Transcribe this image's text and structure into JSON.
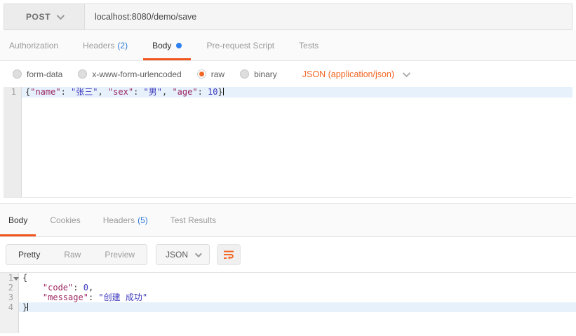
{
  "request": {
    "method": "POST",
    "url": "localhost:8080/demo/save",
    "tabs": {
      "authorization": "Authorization",
      "headers": "Headers",
      "headers_count": "(2)",
      "body": "Body",
      "prerequest": "Pre-request Script",
      "tests": "Tests"
    },
    "body_types": {
      "form_data": "form-data",
      "urlencoded": "x-www-form-urlencoded",
      "raw": "raw",
      "binary": "binary",
      "selected": "raw"
    },
    "content_type": "JSON (application/json)",
    "editor": {
      "line_number": "1",
      "tokens": [
        {
          "type": "punct",
          "text": "{"
        },
        {
          "type": "key",
          "text": "\"name\""
        },
        {
          "type": "punct",
          "text": ": "
        },
        {
          "type": "str",
          "text": "\"张三\""
        },
        {
          "type": "punct",
          "text": ", "
        },
        {
          "type": "key",
          "text": "\"sex\""
        },
        {
          "type": "punct",
          "text": ": "
        },
        {
          "type": "str",
          "text": "\"男\""
        },
        {
          "type": "punct",
          "text": ", "
        },
        {
          "type": "key",
          "text": "\"age\""
        },
        {
          "type": "punct",
          "text": ": "
        },
        {
          "type": "num",
          "text": "10"
        },
        {
          "type": "punct",
          "text": "}"
        }
      ]
    }
  },
  "response": {
    "tabs": {
      "body": "Body",
      "cookies": "Cookies",
      "headers": "Headers",
      "headers_count": "(5)",
      "test_results": "Test Results"
    },
    "toolbar": {
      "pretty": "Pretty",
      "raw": "Raw",
      "preview": "Preview",
      "format": "JSON"
    },
    "editor": {
      "lines": [
        {
          "no": "1",
          "tokens": [
            {
              "type": "punct",
              "text": "{"
            }
          ]
        },
        {
          "no": "2",
          "tokens": [
            {
              "type": "punct",
              "text": "    "
            },
            {
              "type": "key",
              "text": "\"code\""
            },
            {
              "type": "punct",
              "text": ": "
            },
            {
              "type": "num",
              "text": "0"
            },
            {
              "type": "punct",
              "text": ","
            }
          ]
        },
        {
          "no": "3",
          "tokens": [
            {
              "type": "punct",
              "text": "    "
            },
            {
              "type": "key",
              "text": "\"message\""
            },
            {
              "type": "punct",
              "text": ": "
            },
            {
              "type": "str",
              "text": "\"创建 成功\""
            }
          ]
        },
        {
          "no": "4",
          "tokens": [
            {
              "type": "punct",
              "text": "}"
            }
          ]
        }
      ]
    }
  },
  "colors": {
    "accent_orange": "#f26724",
    "underline_orange": "#f0571f",
    "badge_blue": "#2d7bd8",
    "dot_blue": "#2e80f0",
    "json_key": "#9b2660",
    "json_value": "#3f3abe",
    "active_line": "#e6f1fb"
  }
}
